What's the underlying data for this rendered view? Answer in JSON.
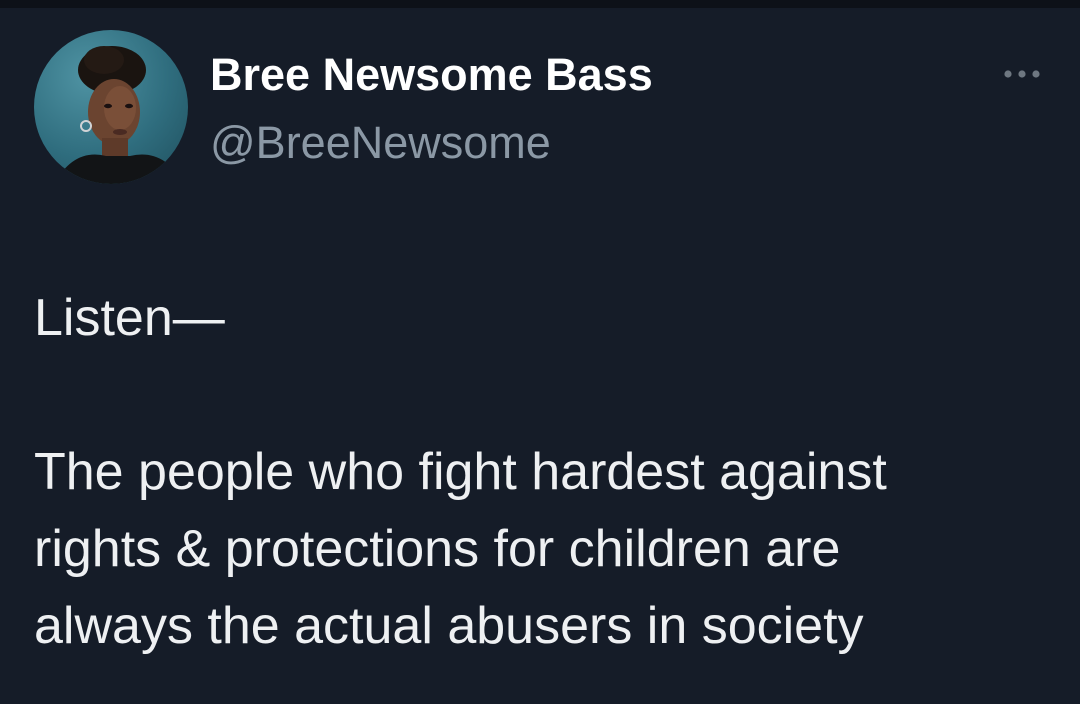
{
  "tweet": {
    "author": {
      "display_name": "Bree Newsome Bass",
      "handle": "@BreeNewsome",
      "avatar_icon": "profile-photo"
    },
    "more_icon": "more-horizontal-icon",
    "text": {
      "line1": "Listen—",
      "line2": "The people who fight hardest against",
      "line3": "rights & protections for children are",
      "line4": "always the actual abusers in society"
    }
  },
  "colors": {
    "background": "#151c28",
    "text": "#e7e9ea",
    "secondary_text": "#8b98a5"
  }
}
